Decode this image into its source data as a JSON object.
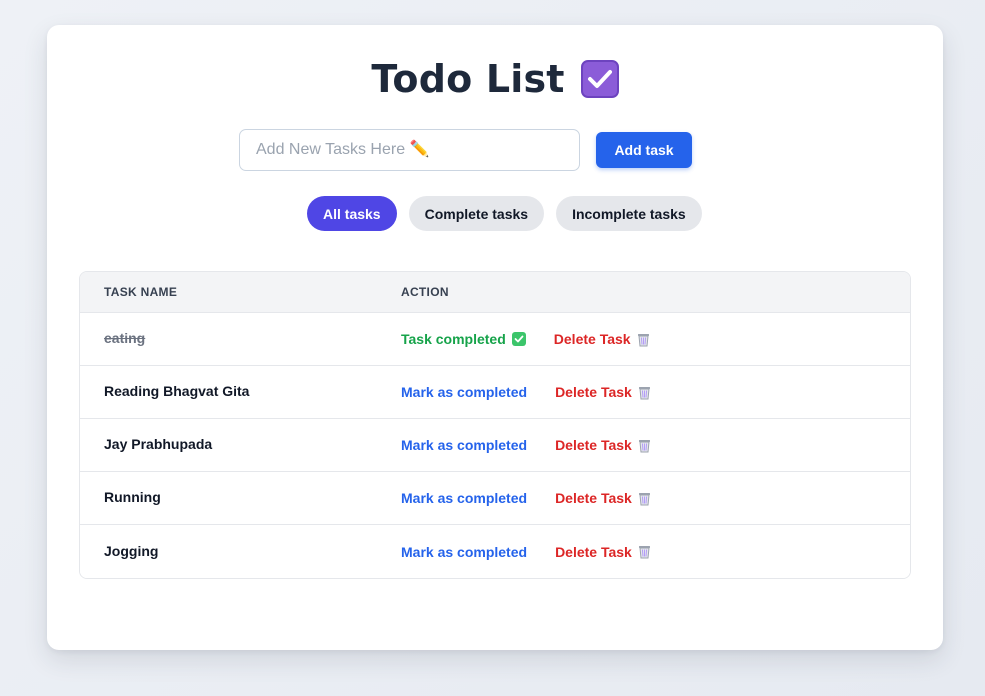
{
  "header": {
    "title": "Todo List",
    "title_icon": "purple-checkbox-icon"
  },
  "input": {
    "placeholder": "Add New Tasks Here ✏️",
    "value": ""
  },
  "add_button": {
    "label": "Add task"
  },
  "filters": [
    {
      "label": "All tasks",
      "active": true
    },
    {
      "label": "Complete tasks",
      "active": false
    },
    {
      "label": "Incomplete tasks",
      "active": false
    }
  ],
  "table": {
    "headers": {
      "task_name": "Task name",
      "action": "Action"
    },
    "rows": [
      {
        "name": "eating",
        "completed": true,
        "status_label": "Task completed",
        "delete_label": "Delete Task"
      },
      {
        "name": "Reading Bhagvat Gita",
        "completed": false,
        "status_label": "Mark as completed",
        "delete_label": "Delete Task"
      },
      {
        "name": "Jay Prabhupada",
        "completed": false,
        "status_label": "Mark as completed",
        "delete_label": "Delete Task"
      },
      {
        "name": "Running",
        "completed": false,
        "status_label": "Mark as completed",
        "delete_label": "Delete Task"
      },
      {
        "name": "Jogging",
        "completed": false,
        "status_label": "Mark as completed",
        "delete_label": "Delete Task"
      }
    ]
  },
  "colors": {
    "primary": "#2563eb",
    "active_filter": "#4f46e5",
    "completed": "#16a34a",
    "delete": "#dc2626"
  }
}
